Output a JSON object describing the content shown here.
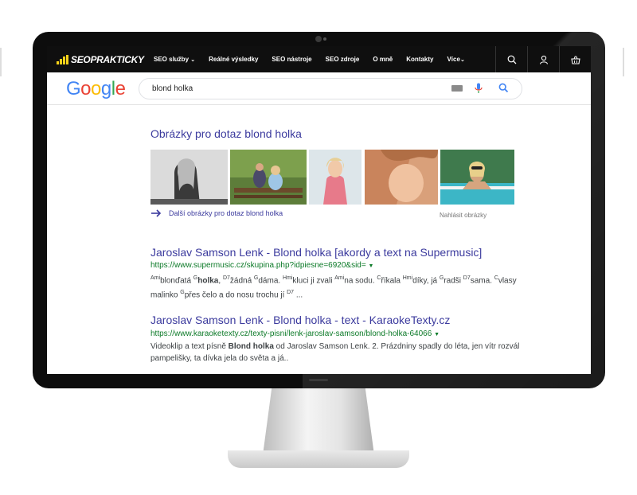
{
  "nav": {
    "logo": "SEOPRAKTICKY",
    "items": [
      "SEO služby",
      "Reálné výsledky",
      "SEO nástroje",
      "SEO zdroje",
      "O mně",
      "Kontakty",
      "Více"
    ]
  },
  "google": {
    "logo_letters": [
      "G",
      "o",
      "o",
      "g",
      "l",
      "e"
    ],
    "logo_colors": [
      "#4285F4",
      "#EA4335",
      "#FBBC05",
      "#4285F4",
      "#34A853",
      "#EA4335"
    ],
    "query": "blond holka"
  },
  "images": {
    "heading": "Obrázky pro dotaz blond holka",
    "more_link": "Další obrázky pro dotaz blond holka",
    "report": "Nahlásit obrázky"
  },
  "results": [
    {
      "title": "Jaroslav Samson Lenk - Blond holka [akordy a text na Supermusic]",
      "url": "https://www.supermusic.cz/skupina.php?idpiesne=6920&sid=",
      "snippet_parts": [
        {
          "sup": "Ami",
          "text": "blonďatá "
        },
        {
          "sup": "G",
          "bold": "holka"
        },
        {
          "text": ", "
        },
        {
          "sup": "D7",
          "text": "žádná "
        },
        {
          "sup": "G",
          "text": "dáma. "
        },
        {
          "sup": "Hmi",
          "text": "kluci ji zvali "
        },
        {
          "sup": "Ami",
          "text": "na sodu. "
        },
        {
          "sup": "C",
          "text": "říkala "
        },
        {
          "sup": "Hmi",
          "text": "díky, já "
        },
        {
          "sup": "G",
          "text": "radši "
        },
        {
          "sup": "D7",
          "text": "sama. "
        },
        {
          "sup": "C",
          "text": "vlasy malinko "
        },
        {
          "sup": "G",
          "text": "přes čelo a do nosu trochu jí "
        },
        {
          "sup": "D7",
          "text": " ..."
        }
      ]
    },
    {
      "title": "Jaroslav Samson Lenk - Blond holka - text - KaraokeTexty.cz",
      "url": "https://www.karaoketexty.cz/texty-pisni/lenk-jaroslav-samson/blond-holka-64066",
      "snippet_parts": [
        {
          "text": "Videoklip a text písně "
        },
        {
          "bold": "Blond holka"
        },
        {
          "text": " od Jaroslav Samson Lenk. 2. Prázdniny spadly do léta, jen vítr rozvál pampelišky, ta dívka jela do světa a já.."
        }
      ]
    }
  ],
  "colors": {
    "link": "#3c3b9e",
    "url": "#0c7a28",
    "logo_yellow": "#f7d21a"
  }
}
